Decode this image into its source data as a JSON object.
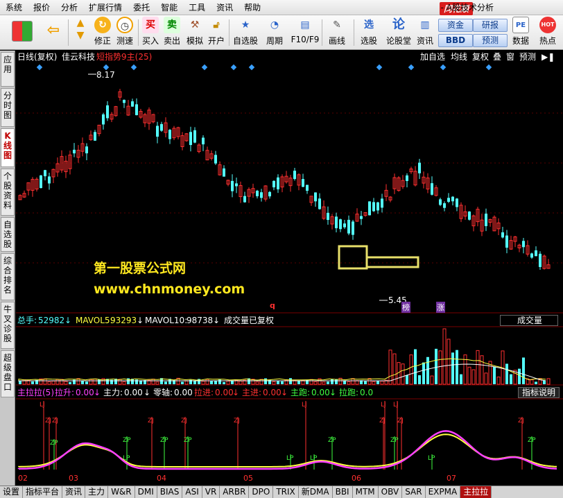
{
  "menu": [
    "系统",
    "报价",
    "分析",
    "扩展行情",
    "委托",
    "智能",
    "工具",
    "资讯",
    "帮助"
  ],
  "brand": "同花顺",
  "app_title": "- A股技术分析",
  "toolbar": {
    "buttons": [
      {
        "label": "修正"
      },
      {
        "label": "测速"
      },
      {
        "label": "买入"
      },
      {
        "label": "卖出"
      },
      {
        "label": "模拟"
      },
      {
        "label": "开户"
      },
      {
        "label": "自选股"
      },
      {
        "label": "周期"
      },
      {
        "label": "F10/F9"
      },
      {
        "label": "画线"
      },
      {
        "label": "选股"
      },
      {
        "label": "论股堂"
      },
      {
        "label": "资讯"
      },
      {
        "label": "数据"
      },
      {
        "label": "热点"
      }
    ],
    "small_buttons": [
      "资金",
      "研报",
      "BBD",
      "预测"
    ],
    "icon_glyphs": {
      "buy": "买",
      "sell": "卖",
      "xuangu": "选",
      "lungu": "论",
      "pe": "PE",
      "hot": "HOT"
    }
  },
  "left_tabs": [
    "应用",
    "分时图",
    "K线图",
    "个股资料",
    "自选股",
    "综合排名",
    "牛叉诊股",
    "超级盘口"
  ],
  "kline_header": {
    "period": "日线(复权)",
    "stock": "佳云科技",
    "indicator": "短指势9主(25)",
    "right_buttons": [
      "加自选",
      "均线",
      "复权",
      "叠",
      "窗",
      "预测"
    ]
  },
  "price_annotations": {
    "high": "8.17",
    "low": "5.45",
    "marker_q": "q",
    "tag_bang": "榜",
    "tag_zhang": "涨"
  },
  "volume_header": {
    "zongshou_label": "总手:",
    "zongshou_value": "52982",
    "mavol5_label": "MAVOL5:",
    "mavol5_value": "93293",
    "mavol10_label": "MAVOL10:",
    "mavol10_value": "98738",
    "note": "成交量已复权",
    "selector": "成交量"
  },
  "indicator_header": {
    "name": "主拉拉(5)",
    "items": [
      {
        "label": "拉升:",
        "value": "0.00"
      },
      {
        "label": "主力:",
        "value": "0.00"
      },
      {
        "label": "零轴:",
        "value": "0.00"
      },
      {
        "label": "拉进:",
        "value": "0.00"
      },
      {
        "label": "主进:",
        "value": "0.00"
      },
      {
        "label": "主跑:",
        "value": "0.00"
      },
      {
        "label": "拉跑:",
        "value": "0.0"
      }
    ],
    "help": "指标说明"
  },
  "signal_labels": {
    "lj": "LJ",
    "zj": "ZJ",
    "zp": "ZP",
    "lp": "LP"
  },
  "month_labels": [
    "02",
    "03",
    "04",
    "05",
    "06",
    "07"
  ],
  "bottom_tabs": [
    "设置",
    "指标平台",
    "资讯",
    "主力",
    "W&R",
    "DMI",
    "BIAS",
    "ASI",
    "VR",
    "ARBR",
    "DPO",
    "TRIX",
    "新DMA",
    "BBI",
    "MTM",
    "OBV",
    "SAR",
    "EXPMA",
    "主拉拉"
  ],
  "watermark": {
    "line1": "第一股票公式网",
    "line2": "www.chnmoney.com"
  },
  "colors": {
    "up": "#ff3030",
    "down": "#54ffff",
    "yellow": "#ffff40",
    "magenta": "#ff40ff",
    "green": "#40ff40",
    "ma": "#ffffff"
  }
}
